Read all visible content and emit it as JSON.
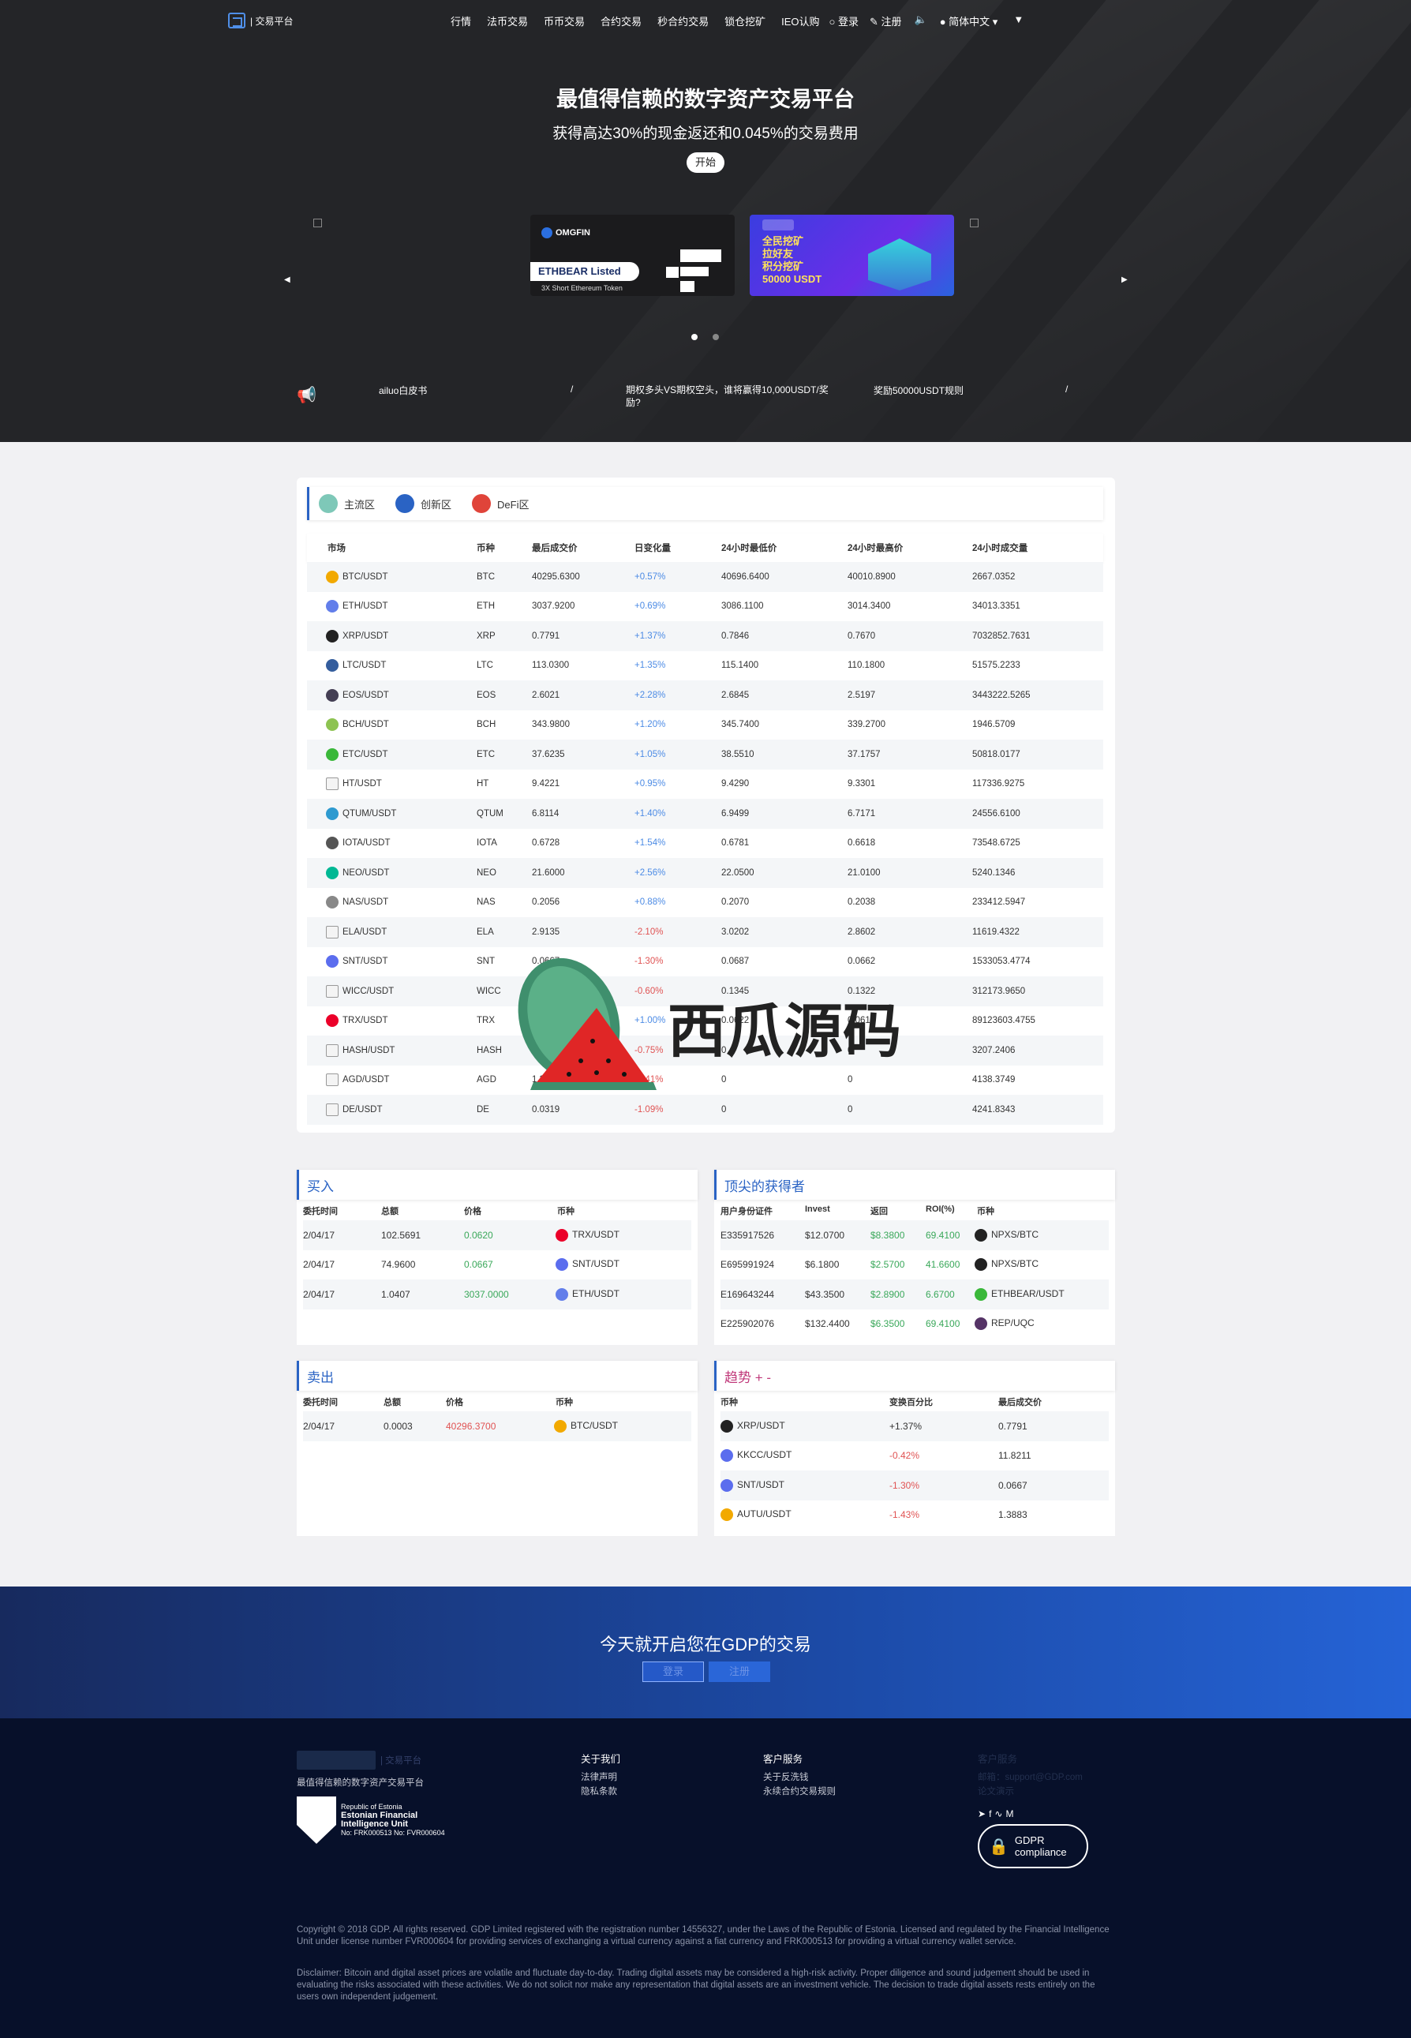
{
  "nav": {
    "logo_text": "| 交易平台",
    "menu": [
      "行情",
      "法币交易",
      "币币交易",
      "合约交易",
      "秒合约交易",
      "锁仓挖矿",
      "IEO认购"
    ],
    "login": "登录",
    "register": "注册",
    "language": "简体中文"
  },
  "hero": {
    "title": "最值得信赖的数字资产交易平台",
    "subtitle": "获得高达30%的现金返还和0.045%的交易费用",
    "start_button": "开始",
    "banner1": {
      "brand": "OMGFIN",
      "badge": "ETHBEAR Listed",
      "caption": "3X Short Ethereum Token"
    },
    "banner2": {
      "lines": [
        "全民挖矿",
        "拉好友",
        "积分挖矿",
        "50000 USDT"
      ]
    }
  },
  "notices": [
    {
      "text": "ailuo白皮书",
      "sep": "/"
    },
    {
      "text": "期权多头VS期权空头，谁将赢得10,000USDT/奖励?"
    },
    {
      "text": "奖励50000USDT规则",
      "sep": "/"
    }
  ],
  "market": {
    "tabs": [
      "主流区",
      "创新区",
      "DeFi区"
    ],
    "columns": [
      "市场",
      "币种",
      "最后成交价",
      "日变化量",
      "24小时最低价",
      "24小时最高价",
      "24小时成交量"
    ],
    "rows": [
      {
        "market": "BTC/USDT",
        "coin": "BTC",
        "last": "40295.6300",
        "change": "+0.57%",
        "low": "40696.6400",
        "high": "40010.8900",
        "volume": "2667.0352",
        "up": true,
        "icon": "btc-icon",
        "color": "#f2a900"
      },
      {
        "market": "ETH/USDT",
        "coin": "ETH",
        "last": "3037.9200",
        "change": "+0.69%",
        "low": "3086.1100",
        "high": "3014.3400",
        "volume": "34013.3351",
        "up": true,
        "icon": "eth-icon",
        "color": "#627eea"
      },
      {
        "market": "XRP/USDT",
        "coin": "XRP",
        "last": "0.7791",
        "change": "+1.37%",
        "low": "0.7846",
        "high": "0.7670",
        "volume": "7032852.7631",
        "up": true,
        "icon": "xrp-icon",
        "color": "#222222"
      },
      {
        "market": "LTC/USDT",
        "coin": "LTC",
        "last": "113.0300",
        "change": "+1.35%",
        "low": "115.1400",
        "high": "110.1800",
        "volume": "51575.2233",
        "up": true,
        "icon": "ltc-icon",
        "color": "#345d9d"
      },
      {
        "market": "EOS/USDT",
        "coin": "EOS",
        "last": "2.6021",
        "change": "+2.28%",
        "low": "2.6845",
        "high": "2.5197",
        "volume": "3443222.5265",
        "up": true,
        "icon": "eos-icon",
        "color": "#443f54"
      },
      {
        "market": "BCH/USDT",
        "coin": "BCH",
        "last": "343.9800",
        "change": "+1.20%",
        "low": "345.7400",
        "high": "339.2700",
        "volume": "1946.5709",
        "up": true,
        "icon": "bch-icon",
        "color": "#8dc351"
      },
      {
        "market": "ETC/USDT",
        "coin": "ETC",
        "last": "37.6235",
        "change": "+1.05%",
        "low": "38.5510",
        "high": "37.1757",
        "volume": "50818.0177",
        "up": true,
        "icon": "etc-icon",
        "color": "#3ab83a"
      },
      {
        "market": "HT/USDT",
        "coin": "HT",
        "last": "9.4221",
        "change": "+0.95%",
        "low": "9.4290",
        "high": "9.3301",
        "volume": "117336.9275",
        "up": true,
        "icon": "broken-image-icon",
        "color": "#999999"
      },
      {
        "market": "QTUM/USDT",
        "coin": "QTUM",
        "last": "6.8114",
        "change": "+1.40%",
        "low": "6.9499",
        "high": "6.7171",
        "volume": "24556.6100",
        "up": true,
        "icon": "qtum-icon",
        "color": "#2e9ad0"
      },
      {
        "market": "IOTA/USDT",
        "coin": "IOTA",
        "last": "0.6728",
        "change": "+1.54%",
        "low": "0.6781",
        "high": "0.6618",
        "volume": "73548.6725",
        "up": true,
        "icon": "iota-icon",
        "color": "#555555"
      },
      {
        "market": "NEO/USDT",
        "coin": "NEO",
        "last": "21.6000",
        "change": "+2.56%",
        "low": "22.0500",
        "high": "21.0100",
        "volume": "5240.1346",
        "up": true,
        "icon": "neo-icon",
        "color": "#00b894"
      },
      {
        "market": "NAS/USDT",
        "coin": "NAS",
        "last": "0.2056",
        "change": "+0.88%",
        "low": "0.2070",
        "high": "0.2038",
        "volume": "233412.5947",
        "up": true,
        "icon": "nas-icon",
        "color": "#888888"
      },
      {
        "market": "ELA/USDT",
        "coin": "ELA",
        "last": "2.9135",
        "change": "-2.10%",
        "low": "3.0202",
        "high": "2.8602",
        "volume": "11619.4322",
        "up": false,
        "icon": "broken-image-icon",
        "color": "#999999"
      },
      {
        "market": "SNT/USDT",
        "coin": "SNT",
        "last": "0.0667",
        "change": "-1.30%",
        "low": "0.0687",
        "high": "0.0662",
        "volume": "1533053.4774",
        "up": false,
        "icon": "snt-icon",
        "color": "#5b6dee"
      },
      {
        "market": "WICC/USDT",
        "coin": "WICC",
        "last": "0.1334",
        "change": "-0.60%",
        "low": "0.1345",
        "high": "0.1322",
        "volume": "312173.9650",
        "up": false,
        "icon": "broken-image-icon",
        "color": "#999999"
      },
      {
        "market": "TRX/USDT",
        "coin": "TRX",
        "last": "0.0620",
        "change": "+1.00%",
        "low": "0.0622",
        "high": "0.0612",
        "volume": "89123603.4755",
        "up": true,
        "icon": "trx-icon",
        "color": "#eb0029"
      },
      {
        "market": "HASH/USDT",
        "coin": "HASH",
        "last": "1.3460",
        "change": "-0.75%",
        "low": "0",
        "high": "0",
        "volume": "3207.2406",
        "up": false,
        "icon": "broken-image-icon",
        "color": "#999999"
      },
      {
        "market": "AGD/USDT",
        "coin": "AGD",
        "last": "1.3460",
        "change": "-0.41%",
        "low": "0",
        "high": "0",
        "volume": "4138.3749",
        "up": false,
        "icon": "broken-image-icon",
        "color": "#999999"
      },
      {
        "market": "DE/USDT",
        "coin": "DE",
        "last": "0.0319",
        "change": "-1.09%",
        "low": "0",
        "high": "0",
        "volume": "4241.8343",
        "up": false,
        "icon": "broken-image-icon",
        "color": "#999999"
      }
    ]
  },
  "buy": {
    "title": "买入",
    "columns": [
      "委托时间",
      "总额",
      "价格",
      "币种"
    ],
    "rows": [
      {
        "time": "2/04/17",
        "amount": "102.5691",
        "price": "0.0620",
        "pair": "TRX/USDT",
        "icon": "trx-icon",
        "color": "#eb0029"
      },
      {
        "time": "2/04/17",
        "amount": "74.9600",
        "price": "0.0667",
        "pair": "SNT/USDT",
        "icon": "snt-icon",
        "color": "#5b6dee"
      },
      {
        "time": "2/04/17",
        "amount": "1.0407",
        "price": "3037.0000",
        "pair": "ETH/USDT",
        "icon": "eth-icon",
        "color": "#627eea"
      }
    ]
  },
  "top": {
    "title": "顶尖的获得者",
    "columns": [
      "用户身份证件",
      "Invest",
      "返回",
      "ROI(%)",
      "币种"
    ],
    "rows": [
      {
        "id": "E335917526",
        "invest": "$12.0700",
        "ret": "$8.3800",
        "roi": "69.4100",
        "pair": "NPXS/BTC",
        "icon": "npxs-icon",
        "color": "#222222"
      },
      {
        "id": "E695991924",
        "invest": "$6.1800",
        "ret": "$2.5700",
        "roi": "41.6600",
        "pair": "NPXS/BTC",
        "icon": "npxs-icon",
        "color": "#222222"
      },
      {
        "id": "E169643244",
        "invest": "$43.3500",
        "ret": "$2.8900",
        "roi": "6.6700",
        "pair": "ETHBEAR/USDT",
        "icon": "etc-icon",
        "color": "#3ab83a"
      },
      {
        "id": "E225902076",
        "invest": "$132.4400",
        "ret": "$6.3500",
        "roi": "69.4100",
        "pair": "REP/UQC",
        "icon": "rep-icon",
        "color": "#553366"
      }
    ]
  },
  "sell": {
    "title": "卖出",
    "columns": [
      "委托时间",
      "总额",
      "价格",
      "币种"
    ],
    "rows": [
      {
        "time": "2/04/17",
        "amount": "0.0003",
        "price": "40296.3700",
        "pair": "BTC/USDT",
        "icon": "btc-icon",
        "color": "#f2a900"
      }
    ]
  },
  "trend": {
    "title": "趋势 + -",
    "columns": [
      "币种",
      "变换百分比",
      "最后成交价"
    ],
    "rows": [
      {
        "pair": "XRP/USDT",
        "change": "+1.37%",
        "last": "0.7791",
        "up": true,
        "icon": "xrp-icon",
        "color": "#222222"
      },
      {
        "pair": "KKCC/USDT",
        "change": "-0.42%",
        "last": "11.8211",
        "up": false,
        "icon": "snt-icon",
        "color": "#5b6dee"
      },
      {
        "pair": "SNT/USDT",
        "change": "-1.30%",
        "last": "0.0667",
        "up": false,
        "icon": "snt-icon",
        "color": "#5b6dee"
      },
      {
        "pair": "AUTU/USDT",
        "change": "-1.43%",
        "last": "1.3883",
        "up": false,
        "icon": "btc-icon",
        "color": "#f2a900"
      }
    ]
  },
  "cta": {
    "title": "今天就开启您在GDP的交易",
    "login": "登录",
    "register": "注册"
  },
  "footer": {
    "logo_text": "| 交易平台",
    "tagline": "最值得信赖的数字资产交易平台",
    "seal": {
      "line1": "Republic of Estonia",
      "line2": "Estonian Financial",
      "line3": "Intelligence Unit",
      "line4": "No: FRK000513 No: FVR000604"
    },
    "about_title": "关于我们",
    "about_links": [
      "法律声明",
      "隐私条款"
    ],
    "service_title": "客户服务",
    "service_links": [
      "关于反洗钱",
      "永续合约交易规则"
    ],
    "contact_title": "客户服务",
    "contact_email": "邮箱：support@GDP.com",
    "contact_more": "论文演示",
    "gdpr": [
      "GDPR",
      "compliance"
    ],
    "copyright": "Copyright © 2018 GDP. All rights reserved. GDP Limited registered with the registration number 14556327, under the Laws of the Republic of Estonia. Licensed and regulated by the Financial Intelligence Unit under license number FVR000604 for providing services of exchanging a virtual currency against a fiat currency and FRK000513 for providing a virtual currency wallet service.",
    "disclaimer": "Disclaimer: Bitcoin and digital asset prices are volatile and fluctuate day-to-day. Trading digital assets may be considered a high-risk activity. Proper diligence and sound judgement should be used in evaluating the risks associated with these activities. We do not solicit nor make any representation that digital assets are an investment vehicle. The decision to trade digital assets rests entirely on the users own independent judgement."
  },
  "watermark": {
    "text": "西瓜源码"
  }
}
